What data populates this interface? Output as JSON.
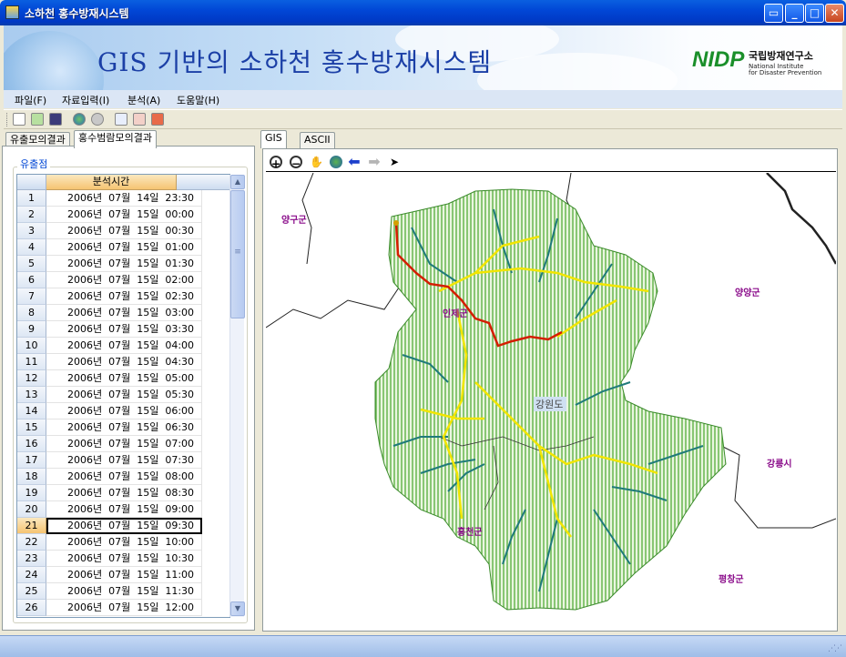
{
  "window": {
    "title": "소하천 홍수방재시스템",
    "minimize_icon": "minimize-icon",
    "maximize_icon": "maximize-icon",
    "close_icon": "close-icon"
  },
  "banner": {
    "title": "GIS 기반의 소하천 홍수방재시스템",
    "logo": "NIDP",
    "institute_ko": "국립방재연구소",
    "institute_en_1": "National Institute",
    "institute_en_2": "for Disaster Prevention"
  },
  "menu": [
    "파일(F)",
    "자료입력(I)",
    "분석(A)",
    "도움말(H)"
  ],
  "toolbar_icons": [
    "open-icon",
    "add-layer-icon",
    "save-icon",
    "globe-icon",
    "weather-icon",
    "copy-icon",
    "export-icon",
    "pdf-icon"
  ],
  "left_tabs": {
    "tab1": "유출모의결과",
    "tab2": "홍수범람모의결과"
  },
  "group_label": "유출점",
  "grid": {
    "column_header": "분석시간",
    "selected_row": 21,
    "rows": [
      {
        "n": "1",
        "t": "2006년  07월  14일  23:30"
      },
      {
        "n": "2",
        "t": "2006년  07월  15일  00:00"
      },
      {
        "n": "3",
        "t": "2006년  07월  15일  00:30"
      },
      {
        "n": "4",
        "t": "2006년  07월  15일  01:00"
      },
      {
        "n": "5",
        "t": "2006년  07월  15일  01:30"
      },
      {
        "n": "6",
        "t": "2006년  07월  15일  02:00"
      },
      {
        "n": "7",
        "t": "2006년  07월  15일  02:30"
      },
      {
        "n": "8",
        "t": "2006년  07월  15일  03:00"
      },
      {
        "n": "9",
        "t": "2006년  07월  15일  03:30"
      },
      {
        "n": "10",
        "t": "2006년  07월  15일  04:00"
      },
      {
        "n": "11",
        "t": "2006년  07월  15일  04:30"
      },
      {
        "n": "12",
        "t": "2006년  07월  15일  05:00"
      },
      {
        "n": "13",
        "t": "2006년  07월  15일  05:30"
      },
      {
        "n": "14",
        "t": "2006년  07월  15일  06:00"
      },
      {
        "n": "15",
        "t": "2006년  07월  15일  06:30"
      },
      {
        "n": "16",
        "t": "2006년  07월  15일  07:00"
      },
      {
        "n": "17",
        "t": "2006년  07월  15일  07:30"
      },
      {
        "n": "18",
        "t": "2006년  07월  15일  08:00"
      },
      {
        "n": "19",
        "t": "2006년  07월  15일  08:30"
      },
      {
        "n": "20",
        "t": "2006년  07월  15일  09:00"
      },
      {
        "n": "21",
        "t": "2006년  07월  15일  09:30"
      },
      {
        "n": "22",
        "t": "2006년  07월  15일  10:00"
      },
      {
        "n": "23",
        "t": "2006년  07월  15일  10:30"
      },
      {
        "n": "24",
        "t": "2006년  07월  15일  11:00"
      },
      {
        "n": "25",
        "t": "2006년  07월  15일  11:30"
      },
      {
        "n": "26",
        "t": "2006년  07월  15일  12:00"
      }
    ]
  },
  "right_tabs": {
    "tab1": "GIS",
    "tab2": "ASCII"
  },
  "map_tools": [
    "zoom-in-icon",
    "zoom-out-icon",
    "pan-hand-icon",
    "full-extent-globe-icon",
    "back-arrow-icon",
    "forward-arrow-icon",
    "select-pointer-icon"
  ],
  "map": {
    "labels": {
      "yanggu": "양구군",
      "inje": "인제군",
      "yangyang": "양양군",
      "gangwon": "강원도",
      "gangneung": "강릉시",
      "hongcheon": "홍천군",
      "pyeongchang": "평창군"
    },
    "colors": {
      "basin_fill": "#8cc56e",
      "stream": "#1f7a7a",
      "main_river": "#f2e600",
      "flow_path": "#d41d00",
      "boundary": "#222222",
      "label": "#8a0b8a"
    }
  }
}
